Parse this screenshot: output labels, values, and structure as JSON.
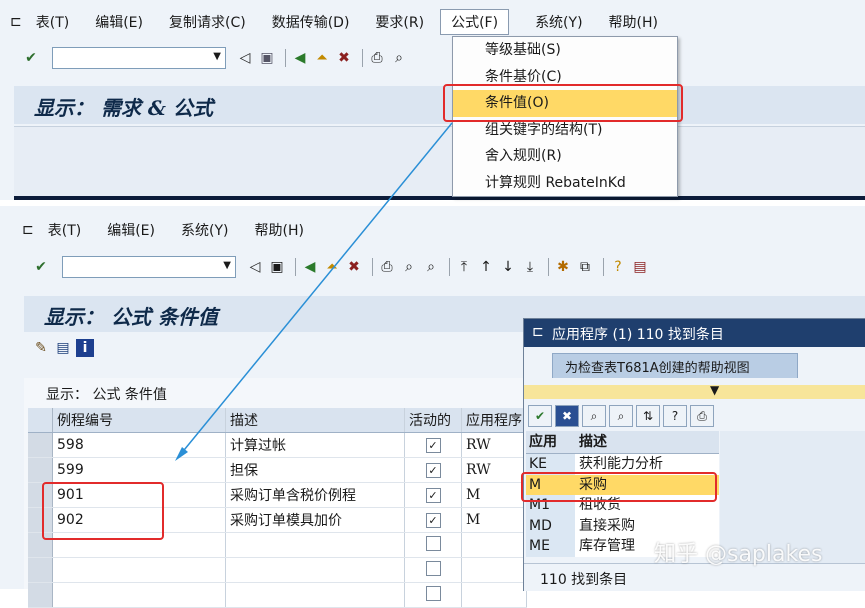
{
  "top": {
    "menu": [
      "表(T)",
      "编辑(E)",
      "复制请求(C)",
      "数据传输(D)",
      "要求(R)",
      "公式(F)",
      "系统(Y)",
      "帮助(H)"
    ],
    "title": "显示： 需求 & 公式",
    "dropdown": [
      "等级基础(S)",
      "条件基价(C)",
      "条件值(O)",
      "组关键字的结构(T)",
      "舍入规则(R)",
      "计算规则 RebateInKd"
    ]
  },
  "bottom": {
    "menu": [
      "表(T)",
      "编辑(E)",
      "系统(Y)",
      "帮助(H)"
    ],
    "title": "显示： 公式 条件值",
    "table_caption": "显示： 公式 条件值",
    "columns": [
      "例程编号",
      "描述",
      "活动的",
      "应用程序"
    ],
    "rows": [
      {
        "no": "598",
        "desc": "计算过帐",
        "active": "✓",
        "app": "RW"
      },
      {
        "no": "599",
        "desc": "担保",
        "active": "✓",
        "app": "RW"
      },
      {
        "no": "901",
        "desc": "采购订单含税价例程",
        "active": "✓",
        "app": "M"
      },
      {
        "no": "902",
        "desc": "采购订单模具加价",
        "active": "✓",
        "app": "M"
      },
      {
        "no": "",
        "desc": "",
        "active": "",
        "app": ""
      },
      {
        "no": "",
        "desc": "",
        "active": "",
        "app": ""
      },
      {
        "no": "",
        "desc": "",
        "active": "",
        "app": ""
      }
    ]
  },
  "popup": {
    "title": "应用程序 (1)  110 找到条目",
    "tab": "为检查表T681A创建的帮助视图",
    "columns": [
      "应用",
      "描述"
    ],
    "rows": [
      {
        "code": "KE",
        "desc": "获利能力分析"
      },
      {
        "code": "M",
        "desc": "采购"
      },
      {
        "code": "M1",
        "desc": "租收货"
      },
      {
        "code": "MD",
        "desc": "直接采购"
      },
      {
        "code": "ME",
        "desc": "库存管理"
      }
    ],
    "status": "110 找到条目"
  },
  "watermark": "知乎 @saplakes",
  "colors": {
    "highlight": "#ffd966",
    "red": "#e22b2b",
    "arrow": "#2a8fd6",
    "panel": "#dbe5f1"
  }
}
